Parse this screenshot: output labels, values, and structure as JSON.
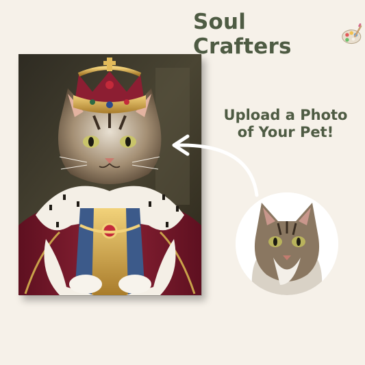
{
  "brand": {
    "name": "Soul Crafters",
    "icon": "palette-icon"
  },
  "headline": {
    "line1": "Upload a Photo",
    "line2": "of Your Pet!"
  },
  "portrait": {
    "subject": "royal-cat-portrait"
  },
  "photo": {
    "subject": "pet-photo"
  },
  "colors": {
    "brand_text": "#4e5b43",
    "background": "#f6f1e9",
    "robe": "#7d1a2b",
    "gold": "#c9a24a"
  }
}
